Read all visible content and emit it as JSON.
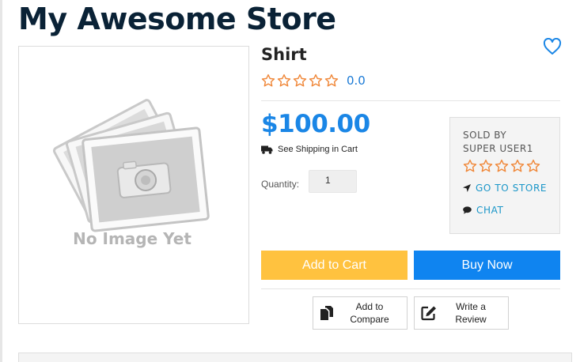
{
  "store": {
    "title": "My Awesome Store"
  },
  "image": {
    "placeholder_text": "No Image Yet",
    "icon": "no-image-placeholder"
  },
  "product": {
    "title": "Shirt",
    "rating": {
      "value": "0.0",
      "stars": 5,
      "filled": 0
    },
    "price": "$100.00",
    "shipping_text": "See Shipping in Cart",
    "quantity_label": "Quantity:",
    "quantity_value": "1"
  },
  "seller": {
    "sold_by_label": "SOLD BY",
    "name": "SUPER USER1",
    "rating": {
      "stars": 5,
      "filled": 0
    },
    "go_to_store_label": "GO TO STORE",
    "chat_label": "CHAT"
  },
  "actions": {
    "add_to_cart": "Add to Cart",
    "buy_now": "Buy Now",
    "compare": {
      "line1": "Add to",
      "line2": "Compare"
    },
    "review": {
      "line1": "Write a",
      "line2": "Review"
    }
  },
  "colors": {
    "accent_blue": "#1a86e6",
    "star_orange": "#f0883a",
    "add_to_cart_bg": "#ffc23f",
    "buy_now_bg": "#0f84f0",
    "seller_link": "#1a96c8"
  },
  "icons": {
    "wishlist": "heart-outline-icon",
    "shipping": "truck-icon",
    "go_to_store": "location-arrow-icon",
    "chat": "comment-icon",
    "compare": "copy-icon",
    "review": "edit-icon"
  }
}
